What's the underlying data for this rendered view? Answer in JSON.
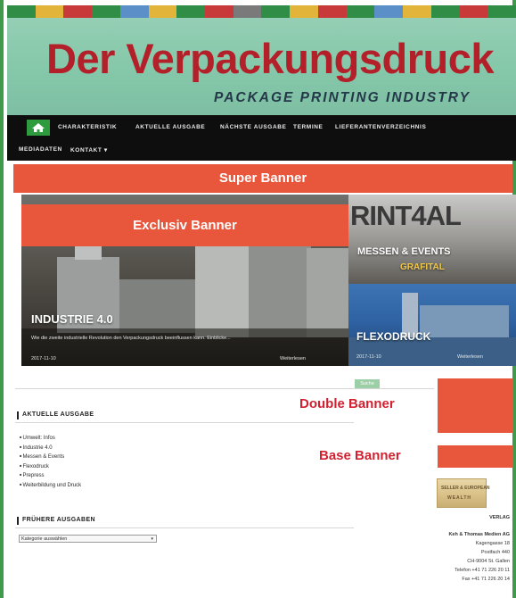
{
  "header": {
    "title": "Der Verpackungsdruck",
    "subtitle": "PACKAGE PRINTING INDUSTRY",
    "stripe_colors": [
      "#2f8d46",
      "#e2b43a",
      "#c83a3a",
      "#2f8d46",
      "#5a8fc8",
      "#e2b43a",
      "#2f8d46",
      "#c83a3a",
      "#7a7a7a",
      "#2f8d46",
      "#e2b43a",
      "#c83a3a",
      "#2f8d46",
      "#5a8fc8",
      "#e2b43a",
      "#2f8d46",
      "#c83a3a",
      "#2f8d46"
    ]
  },
  "nav": {
    "home_icon": "home-icon",
    "items": [
      {
        "label": "CHARAKTERISTIK"
      },
      {
        "label": "AKTUELLE AUSGABE"
      },
      {
        "label": "NÄCHSTE AUSGABE"
      },
      {
        "label": "TERMINE"
      },
      {
        "label": "LIEFERANTENVERZEICHNIS"
      },
      {
        "label": "MEDIADATEN"
      },
      {
        "label": "KONTAKT ▾"
      }
    ]
  },
  "banners": {
    "super": "Super Banner",
    "exclusiv": "Exclusiv Banner",
    "double": "Double Banner",
    "base": "Base Banner"
  },
  "tiles": {
    "main": {
      "caption": "INDUSTRIE 4.0",
      "teaser": "Wie die zweite industrielle Revolution den Verpackungsdruck beeinflussen kann. Einblicke...",
      "date": "2017-11-10",
      "more": "Weiterlesen"
    },
    "side_top": {
      "caption": "RINT4AL",
      "sub": "MESSEN & EVENTS",
      "sub2": "GRAFITAL"
    },
    "side_bottom": {
      "caption": "FLEXODRUCK",
      "date": "2017-11-10",
      "more": "Weiterlesen"
    }
  },
  "content": {
    "green_button": "Suche",
    "current_title": "AKTUELLE AUSGABE",
    "current_items": [
      "Umwelt: Infos",
      "Industrie 4.0",
      "Messen & Events",
      "Flexodruck",
      "Prepress",
      "Weiterbildung und Druck"
    ],
    "past_title": "FRÜHERE AUSGABEN",
    "select_value": "Kategorie auswählen"
  },
  "sidebar": {
    "badge_line1": "SELLER & EUROPEAN",
    "badge_line2": "WEALTH",
    "verlag_label": "VERLAG",
    "address": [
      "Keh & Thomas Medien AG",
      "Kagengasse 18",
      "Postfach 440",
      "CH-9004 St. Gallen",
      "Telefon +41 71 226 20 11",
      "Fax +41 71 226 20 14"
    ]
  },
  "colors": {
    "accent_orange": "#e8573c",
    "brand_red": "#b3202a",
    "label_red": "#d12130",
    "nav_bg": "#0e0e0e",
    "green": "#2e9b3e",
    "header_bg": "#8fcbb2"
  }
}
